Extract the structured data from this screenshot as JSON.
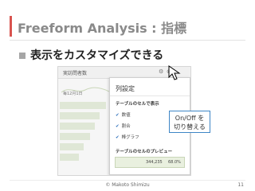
{
  "slide": {
    "title": "Freeform Analysis : 指標",
    "bullet": "表示をカスタマイズできる",
    "accent_color": "#d9534f"
  },
  "widget": {
    "title": "実訪問者数",
    "header_icons": [
      "gear-icon",
      "close-icon"
    ],
    "background_axis_label": "毎12月1日"
  },
  "dialog": {
    "title": "列設定",
    "section_display": "テーブルのセルで表示",
    "options": [
      {
        "label": "数値",
        "checked": true
      },
      {
        "label": "割合",
        "checked": true
      },
      {
        "label": "棒グラフ",
        "checked": true
      }
    ],
    "section_preview": "テーブルのセルのプレビュー",
    "preview_value": "344,235",
    "preview_percent": "68.0%"
  },
  "callout": {
    "line1": "On/Off を",
    "line2": "切り替える",
    "border_color": "#3e86c6"
  },
  "footer": {
    "copyright": "© Makoto Shimizu",
    "page_number": "11"
  }
}
